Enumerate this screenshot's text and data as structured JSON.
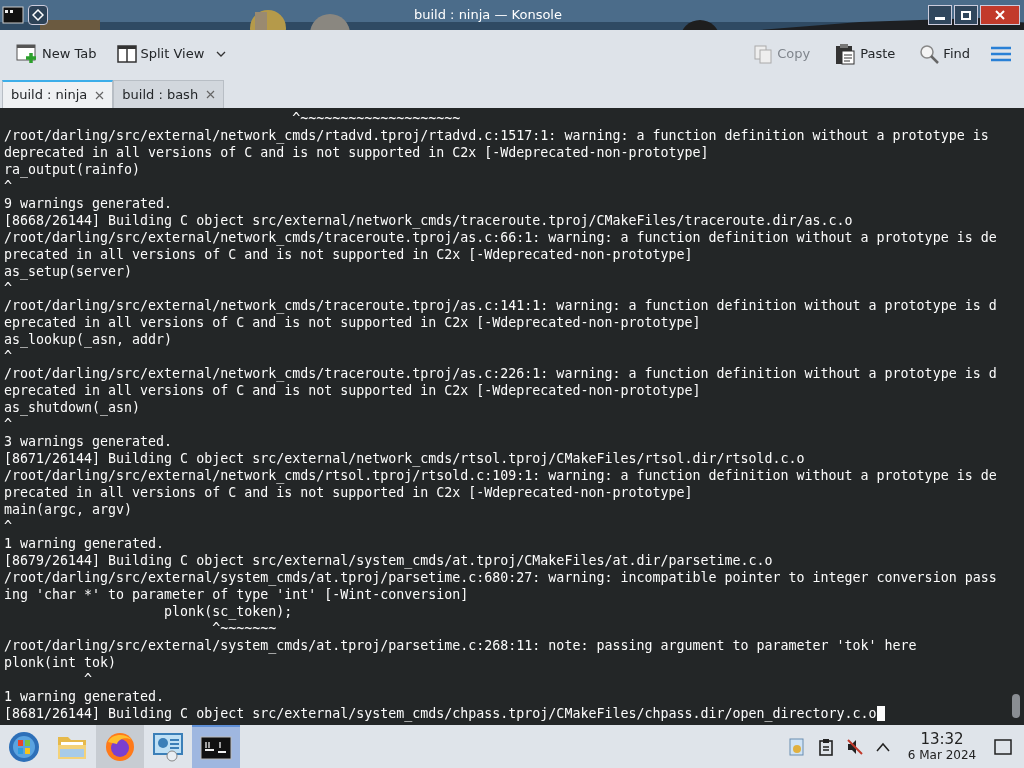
{
  "window": {
    "title": "build : ninja — Konsole"
  },
  "toolbar": {
    "left": [
      {
        "kind": "new-tab",
        "label": "New Tab"
      },
      {
        "kind": "split-view",
        "label": "Split View"
      }
    ],
    "right": [
      {
        "kind": "copy",
        "label": "Copy",
        "disabled": true
      },
      {
        "kind": "paste",
        "label": "Paste",
        "disabled": false
      },
      {
        "kind": "find",
        "label": "Find",
        "disabled": false
      }
    ]
  },
  "tabs": [
    {
      "label": "build : ninja",
      "selected": true
    },
    {
      "label": "build : bash",
      "selected": false
    }
  ],
  "terminal": {
    "lines": [
      "                                    ^~~~~~~~~~~~~~~~~~~~~",
      "/root/darling/src/external/network_cmds/rtadvd.tproj/rtadvd.c:1517:1: warning: a function definition without a prototype is",
      "deprecated in all versions of C and is not supported in C2x [-Wdeprecated-non-prototype]",
      "ra_output(rainfo)",
      "^",
      "9 warnings generated.",
      "[8668/26144] Building C object src/external/network_cmds/traceroute.tproj/CMakeFiles/traceroute.dir/as.c.o",
      "/root/darling/src/external/network_cmds/traceroute.tproj/as.c:66:1: warning: a function definition without a prototype is de",
      "precated in all versions of C and is not supported in C2x [-Wdeprecated-non-prototype]",
      "as_setup(server)",
      "^",
      "/root/darling/src/external/network_cmds/traceroute.tproj/as.c:141:1: warning: a function definition without a prototype is d",
      "eprecated in all versions of C and is not supported in C2x [-Wdeprecated-non-prototype]",
      "as_lookup(_asn, addr)",
      "^",
      "/root/darling/src/external/network_cmds/traceroute.tproj/as.c:226:1: warning: a function definition without a prototype is d",
      "eprecated in all versions of C and is not supported in C2x [-Wdeprecated-non-prototype]",
      "as_shutdown(_asn)",
      "^",
      "3 warnings generated.",
      "[8671/26144] Building C object src/external/network_cmds/rtsol.tproj/CMakeFiles/rtsol.dir/rtsold.c.o",
      "/root/darling/src/external/network_cmds/rtsol.tproj/rtsold.c:109:1: warning: a function definition without a prototype is de",
      "precated in all versions of C and is not supported in C2x [-Wdeprecated-non-prototype]",
      "main(argc, argv)",
      "^",
      "1 warning generated.",
      "[8679/26144] Building C object src/external/system_cmds/at.tproj/CMakeFiles/at.dir/parsetime.c.o",
      "/root/darling/src/external/system_cmds/at.tproj/parsetime.c:680:27: warning: incompatible pointer to integer conversion pass",
      "ing 'char *' to parameter of type 'int' [-Wint-conversion]",
      "                    plonk(sc_token);",
      "                          ^~~~~~~~",
      "/root/darling/src/external/system_cmds/at.tproj/parsetime.c:268:11: note: passing argument to parameter 'tok' here",
      "plonk(int tok)",
      "          ^",
      "1 warning generated.",
      "[8681/26144] Building C object src/external/system_cmds/chpass.tproj/CMakeFiles/chpass.dir/open_directory.c.o"
    ]
  },
  "taskbar": {
    "apps": [
      {
        "kind": "start",
        "open": false,
        "active": false
      },
      {
        "kind": "folder",
        "open": false,
        "active": false
      },
      {
        "kind": "browser",
        "open": true,
        "active": false
      },
      {
        "kind": "remote",
        "open": false,
        "active": false
      },
      {
        "kind": "terminal",
        "open": true,
        "active": true
      }
    ],
    "clock": {
      "time": "13:32",
      "date": "6 Mar 2024"
    }
  }
}
